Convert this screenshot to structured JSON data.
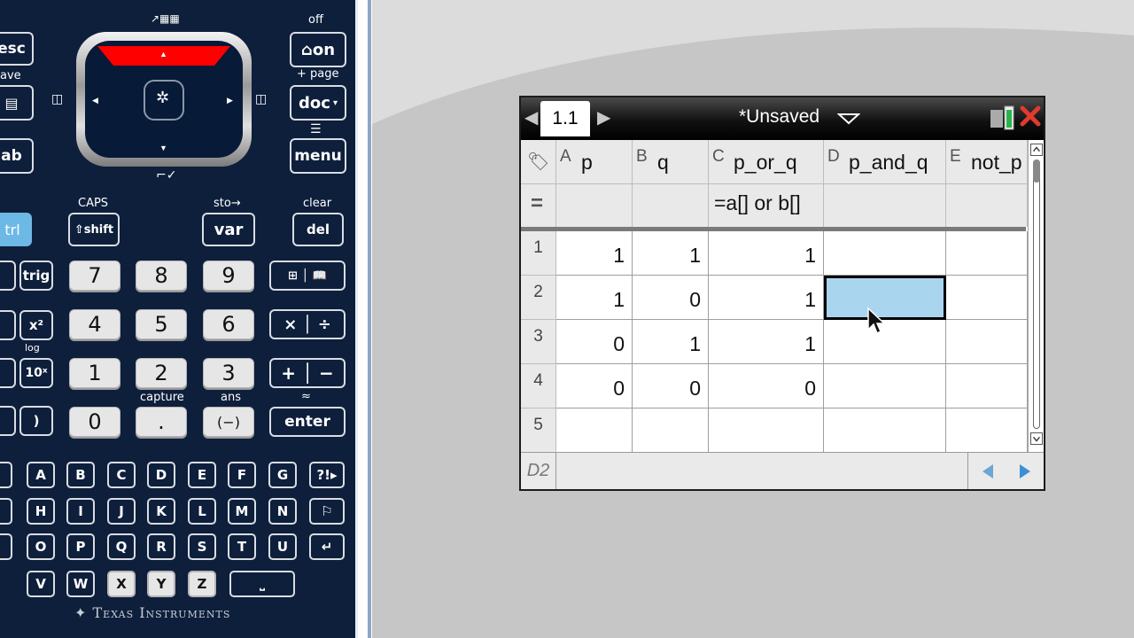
{
  "handheld": {
    "brand": "Texas Instruments",
    "keys": {
      "esc": "esc",
      "on": "on",
      "doc": "doc",
      "menu": "menu",
      "tab": "ab",
      "ctrl": "trl",
      "shift": "shift",
      "var": "var",
      "del": "del",
      "trig": "trig",
      "x2": "x²",
      "tenx": "10ˣ",
      "rparen": ")",
      "n7": "7",
      "n8": "8",
      "n9": "9",
      "n4": "4",
      "n5": "5",
      "n6": "6",
      "n1": "1",
      "n2": "2",
      "n3": "3",
      "n0": "0",
      "dot": ".",
      "neg": "(−)",
      "times": "×",
      "divide": "÷",
      "plus": "+",
      "minus": "−",
      "enter": "enter"
    },
    "labels": {
      "off": "off",
      "page": "+ page",
      "save": "ave",
      "caps": "CAPS",
      "sto": "sto→",
      "clear": "clear",
      "capture": "capture",
      "ans": "ans",
      "log": "log",
      "approx": "≈"
    },
    "letters": [
      "A",
      "B",
      "C",
      "D",
      "E",
      "F",
      "G",
      "?!▸",
      "H",
      "I",
      "J",
      "K",
      "L",
      "M",
      "N",
      "⚐",
      "O",
      "P",
      "Q",
      "R",
      "S",
      "T",
      "U",
      "↵",
      "V",
      "W",
      "X",
      "Y",
      "Z"
    ]
  },
  "screen": {
    "tab_label": "1.1",
    "document_title": "*Unsaved",
    "columns": [
      {
        "letter": "A",
        "name": "p",
        "formula": ""
      },
      {
        "letter": "B",
        "name": "q",
        "formula": ""
      },
      {
        "letter": "C",
        "name": "p_or_q",
        "formula": "=a[] or b[]"
      },
      {
        "letter": "D",
        "name": "p_and_q",
        "formula": ""
      },
      {
        "letter": "E",
        "name": "not_p",
        "formula": ""
      }
    ],
    "formula_row_symbol": "=",
    "rows": [
      {
        "num": "1",
        "cells": [
          "1",
          "1",
          "1",
          "",
          ""
        ]
      },
      {
        "num": "2",
        "cells": [
          "1",
          "0",
          "1",
          "",
          ""
        ]
      },
      {
        "num": "3",
        "cells": [
          "0",
          "1",
          "1",
          "",
          ""
        ]
      },
      {
        "num": "4",
        "cells": [
          "0",
          "0",
          "0",
          "",
          ""
        ]
      },
      {
        "num": "5",
        "cells": [
          "",
          "",
          "",
          "",
          ""
        ]
      }
    ],
    "selected_cell": "D2",
    "entry_cell_ref": "D2",
    "accent": "#a9d5ef",
    "close_color": "#e03a2e"
  }
}
